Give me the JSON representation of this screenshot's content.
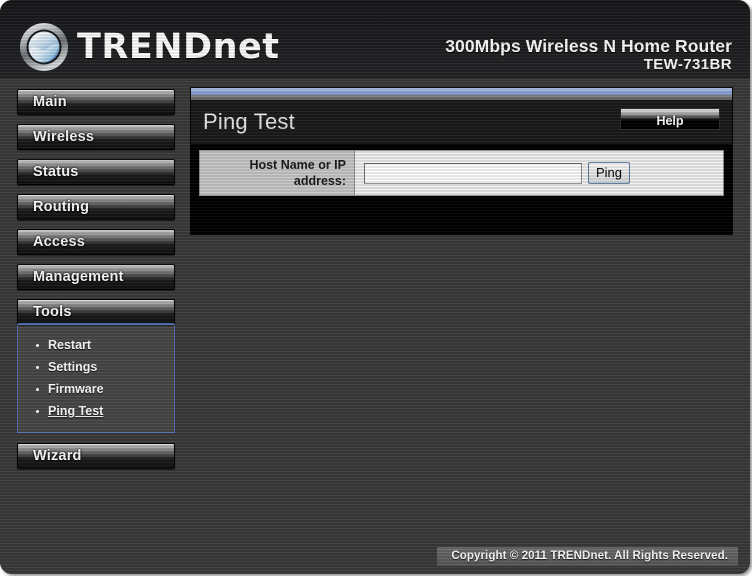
{
  "header": {
    "brand": "TRENDnet",
    "logo_icon": "trendnet-sphere-logo",
    "product_name": "300Mbps Wireless N Home Router",
    "model_number": "TEW-731BR"
  },
  "sidebar": {
    "items": [
      {
        "label": "Main",
        "active": false
      },
      {
        "label": "Wireless",
        "active": false
      },
      {
        "label": "Status",
        "active": false
      },
      {
        "label": "Routing",
        "active": false
      },
      {
        "label": "Access",
        "active": false
      },
      {
        "label": "Management",
        "active": false
      },
      {
        "label": "Tools",
        "active": true
      },
      {
        "label": "Wizard",
        "active": false
      }
    ],
    "submenu": [
      {
        "label": "Restart",
        "current": false
      },
      {
        "label": "Settings",
        "current": false
      },
      {
        "label": "Firmware",
        "current": false
      },
      {
        "label": "Ping Test",
        "current": true
      }
    ]
  },
  "main": {
    "title": "Ping Test",
    "help_label": "Help",
    "form": {
      "host_label": "Host Name or IP address:",
      "host_value": "",
      "host_placeholder": "",
      "submit_label": "Ping"
    }
  },
  "footer": {
    "copyright": "Copyright © 2011 TRENDnet. All Rights Reserved."
  },
  "colors": {
    "accent_blue": "#4f6fb5",
    "panel_topbar": "#8fa9da",
    "frame_dark": "#3b3b3b",
    "panel_black": "#000000",
    "label_cell": "#c8c8c8"
  }
}
